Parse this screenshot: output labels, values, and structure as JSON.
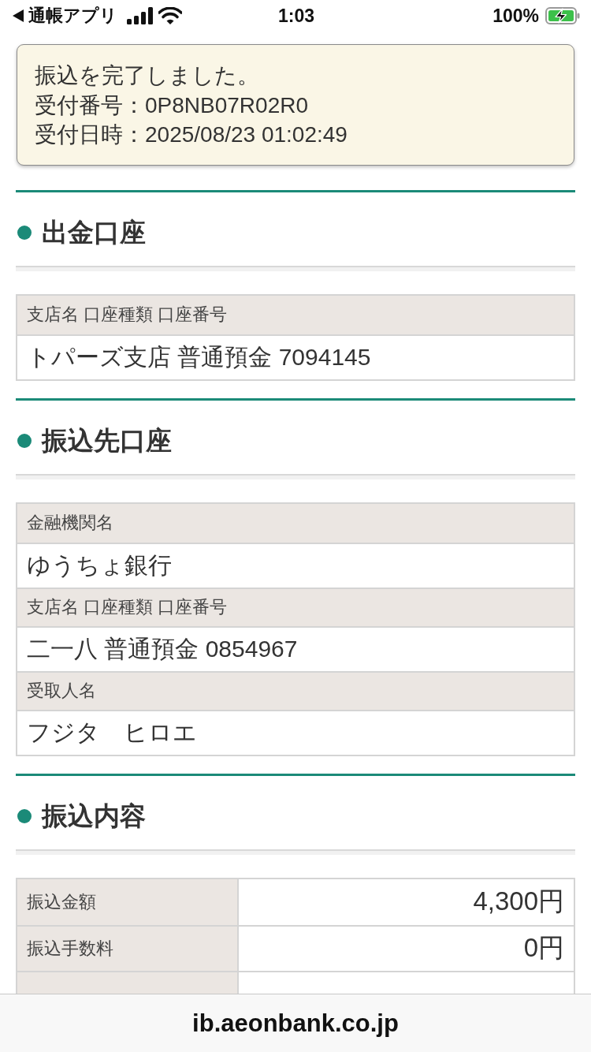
{
  "status_bar": {
    "back_label": "通帳アプリ",
    "time": "1:03",
    "battery": "100%"
  },
  "notice": {
    "lines": [
      "振込を完了しました。",
      "受付番号：0P8NB07R02R0",
      "受付日時：2025/08/23 01:02:49"
    ]
  },
  "sections": [
    {
      "title": "出金口座",
      "table": {
        "kind": "stacked",
        "rows": [
          {
            "label": "支店名 口座種類 口座番号",
            "value": "トパーズ支店 普通預金 7094145"
          }
        ]
      }
    },
    {
      "title": "振込先口座",
      "table": {
        "kind": "stacked",
        "rows": [
          {
            "label": "金融機関名",
            "value": "ゆうちょ銀行"
          },
          {
            "label": "支店名 口座種類 口座番号",
            "value": "二一八 普通預金 0854967"
          },
          {
            "label": "受取人名",
            "value": "フジタ　ヒロエ"
          }
        ]
      }
    },
    {
      "title": "振込内容",
      "table": {
        "kind": "side",
        "rows": [
          {
            "label": "振込金額",
            "value": "4,300円"
          },
          {
            "label": "振込手数料",
            "value": "0円"
          }
        ]
      }
    }
  ],
  "footer": {
    "url": "ib.aeonbank.co.jp"
  }
}
